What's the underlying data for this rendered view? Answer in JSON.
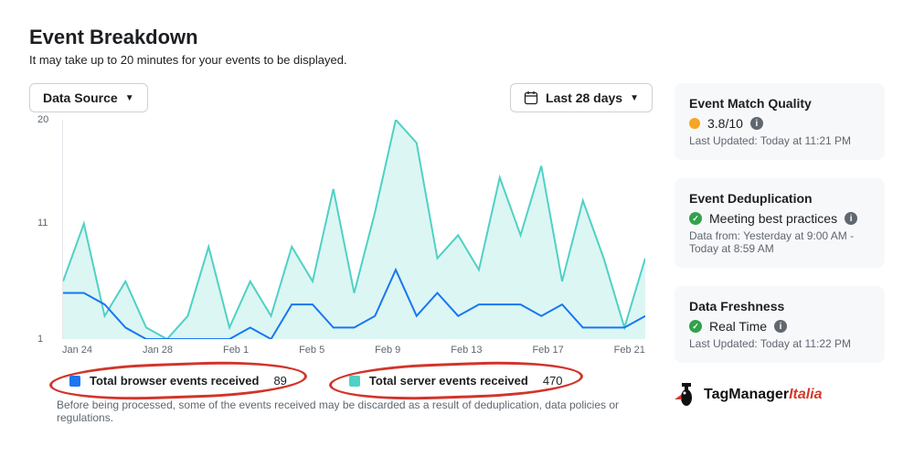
{
  "header": {
    "title": "Event Breakdown",
    "subtitle": "It may take up to 20 minutes for your events to be displayed."
  },
  "toolbar": {
    "data_source_label": "Data Source",
    "date_range_label": "Last 28 days"
  },
  "chart_data": {
    "type": "line",
    "xlabel": "",
    "ylabel": "",
    "ylim": [
      1,
      20
    ],
    "categories": [
      "Jan 24",
      "Jan 25",
      "Jan 26",
      "Jan 27",
      "Jan 28",
      "Jan 29",
      "Jan 30",
      "Jan 31",
      "Feb 1",
      "Feb 2",
      "Feb 3",
      "Feb 4",
      "Feb 5",
      "Feb 6",
      "Feb 7",
      "Feb 8",
      "Feb 9",
      "Feb 10",
      "Feb 11",
      "Feb 12",
      "Feb 13",
      "Feb 14",
      "Feb 15",
      "Feb 16",
      "Feb 17",
      "Feb 18",
      "Feb 19",
      "Feb 20",
      "Feb 21"
    ],
    "x_tick_labels": [
      "Jan 24",
      "Jan 28",
      "Feb 1",
      "Feb 5",
      "Feb 9",
      "Feb 13",
      "Feb 17",
      "Feb 21"
    ],
    "y_tick_labels": [
      "1",
      "11",
      "20"
    ],
    "series": [
      {
        "name": "Total browser events received",
        "color": "#1877f2",
        "total": 89,
        "values": [
          5,
          5,
          4,
          2,
          1,
          1,
          1,
          1,
          1,
          2,
          1,
          4,
          4,
          2,
          2,
          3,
          7,
          3,
          5,
          3,
          4,
          4,
          4,
          3,
          4,
          2,
          2,
          2,
          3
        ]
      },
      {
        "name": "Total server events received",
        "color": "#4fd1c5",
        "total": 470,
        "values": [
          6,
          11,
          3,
          6,
          2,
          1,
          3,
          9,
          2,
          6,
          3,
          9,
          6,
          14,
          5,
          12,
          20,
          18,
          8,
          10,
          7,
          15,
          10,
          16,
          6,
          13,
          8,
          2,
          8
        ]
      }
    ]
  },
  "legend_note": "Before being processed, some of the events received may be discarded as a result of deduplication, data policies or regulations.",
  "cards": {
    "match_quality": {
      "title": "Event Match Quality",
      "score": "3.8/10",
      "meta": "Last Updated: Today at 11:21 PM"
    },
    "dedup": {
      "title": "Event Deduplication",
      "status": "Meeting best practices",
      "meta": "Data from: Yesterday at 9:00 AM - Today at 8:59 AM"
    },
    "freshness": {
      "title": "Data Freshness",
      "status": "Real Time",
      "meta": "Last Updated: Today at 11:22 PM"
    }
  },
  "branding": {
    "part1": "TagManager",
    "part2": "Italia"
  }
}
